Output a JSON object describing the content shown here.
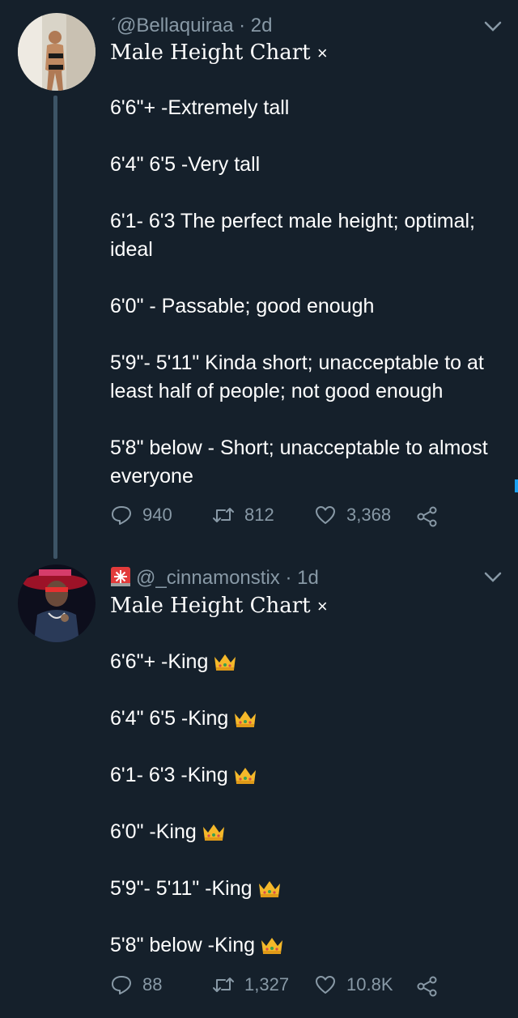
{
  "tweets": [
    {
      "handle": "ˊ@Bellaquiraa · 2d",
      "title": "Male Height Chart",
      "close_glyph": "×",
      "lines": [
        "6'6\"+ -Extremely tall",
        "6'4\" 6'5 -Very tall",
        "6'1- 6'3 The perfect male height; optimal; ideal",
        "6'0\" - Passable; good enough",
        "5'9\"- 5'11\" Kinda short; unacceptable to at least half of people; not good enough",
        "5'8\" below - Short; unacceptable to almost everyone"
      ],
      "replies": "940",
      "retweets": "812",
      "likes": "3,368"
    },
    {
      "handle": "@_cinnamonstix · 1d",
      "title": "Male Height Chart",
      "close_glyph": "×",
      "lines": [
        "6'6\"+ -King",
        "6'4\" 6'5 -King",
        "6'1- 6'3 -King",
        "6'0\" -King",
        "5'9\"- 5'11\" -King",
        "5'8\" below -King"
      ],
      "replies": "88",
      "retweets": "1,327",
      "likes": "10.8K"
    }
  ],
  "icons": {
    "reply": "reply-icon",
    "retweet": "retweet-icon",
    "like": "heart-icon",
    "share": "share-icon",
    "crown": "crown-icon",
    "siren": "siren-icon",
    "chevron": "chevron-down-icon"
  },
  "colors": {
    "background": "#15202b",
    "secondary_text": "#8899a6",
    "thread_line": "#3d5466",
    "accent": "#1da1f2"
  }
}
